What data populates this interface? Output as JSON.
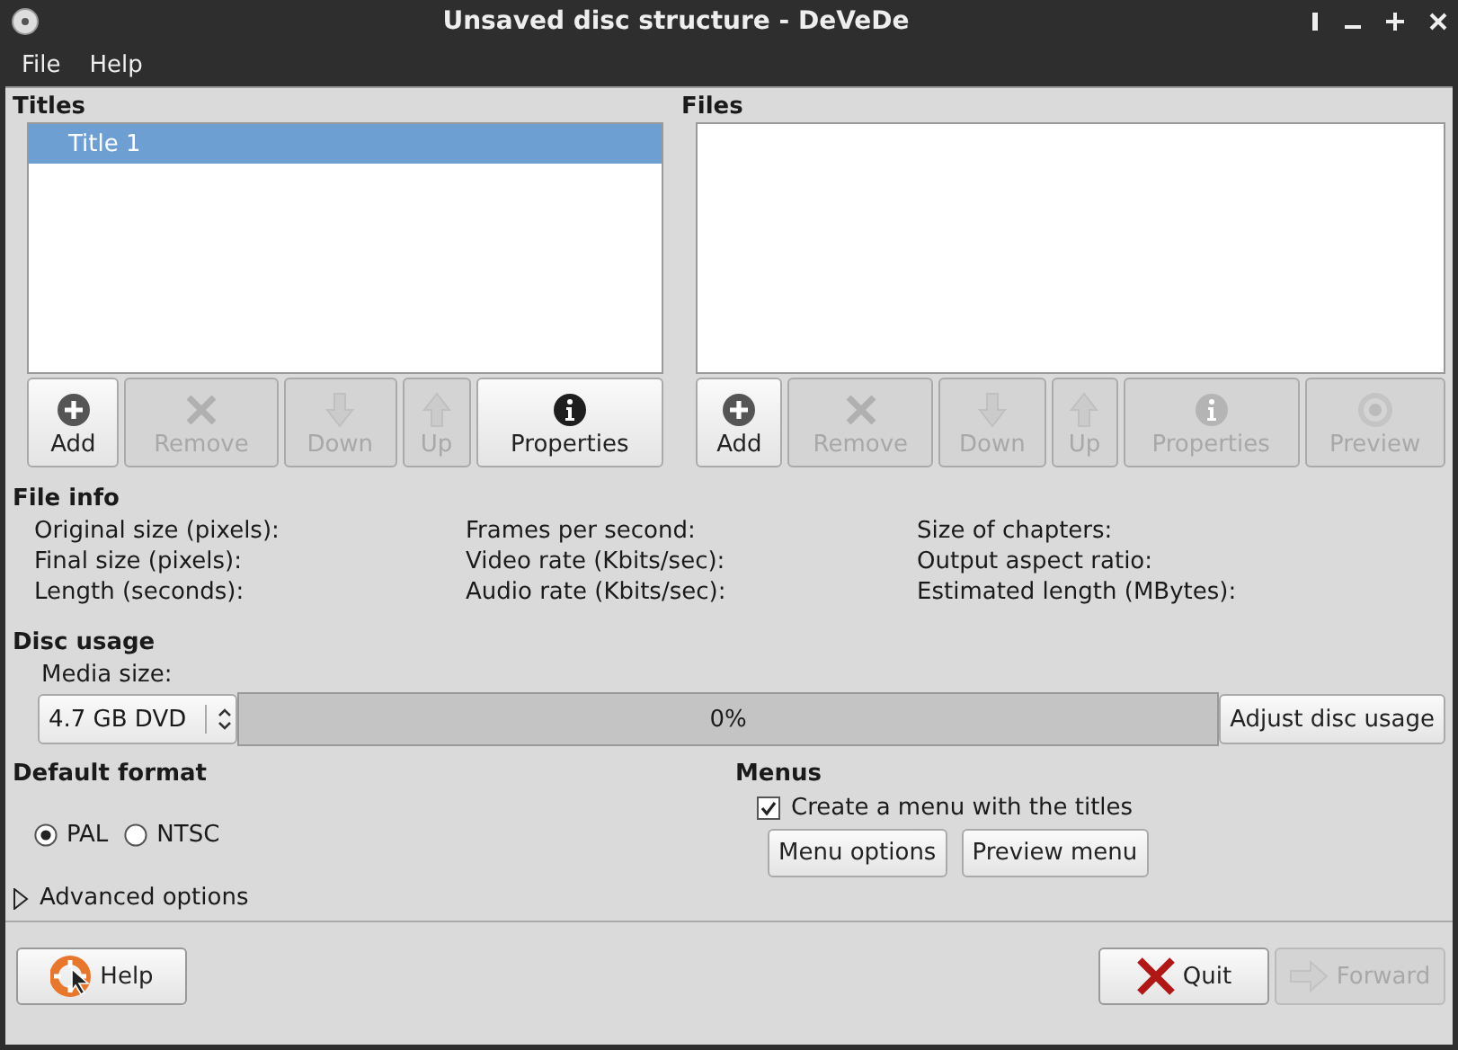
{
  "window": {
    "title": "Unsaved disc structure - DeVeDe"
  },
  "menu": [
    "File",
    "Help"
  ],
  "titles": {
    "heading": "Titles",
    "items": [
      {
        "label": "Title 1",
        "selected": true
      }
    ],
    "buttons": [
      {
        "label": "Add",
        "kind": "add",
        "disabled": false
      },
      {
        "label": "Remove",
        "kind": "remove",
        "disabled": true
      },
      {
        "label": "Down",
        "kind": "down",
        "disabled": true
      },
      {
        "label": "Up",
        "kind": "up",
        "disabled": true
      },
      {
        "label": "Properties",
        "kind": "info",
        "disabled": false
      }
    ]
  },
  "files": {
    "heading": "Files",
    "buttons": [
      {
        "label": "Add",
        "kind": "add",
        "disabled": false
      },
      {
        "label": "Remove",
        "kind": "remove",
        "disabled": true
      },
      {
        "label": "Down",
        "kind": "down",
        "disabled": true
      },
      {
        "label": "Up",
        "kind": "up",
        "disabled": true
      },
      {
        "label": "Properties",
        "kind": "info",
        "disabled": true
      },
      {
        "label": "Preview",
        "kind": "preview",
        "disabled": true
      }
    ]
  },
  "file_info": {
    "heading": "File info",
    "columns": [
      [
        "Original size (pixels):",
        "Final size (pixels):",
        "Length (seconds):"
      ],
      [
        "Frames per second:",
        "Video rate (Kbits/sec):",
        "Audio rate (Kbits/sec):"
      ],
      [
        "Size of chapters:",
        "Output aspect ratio:",
        "Estimated length (MBytes):"
      ]
    ]
  },
  "disc_usage": {
    "heading": "Disc usage",
    "media_label": "Media size:",
    "media_size": "4.7 GB DVD",
    "level": 0,
    "reading": "0%",
    "button": "Adjust disc usage"
  },
  "default_format": {
    "heading": "Default format",
    "options": [
      {
        "label": "PAL",
        "selected": true
      },
      {
        "label": "NTSC",
        "selected": false
      }
    ]
  },
  "menus": {
    "heading": "Menus",
    "checkbox": {
      "label": "Create a menu with the titles",
      "checked": true
    },
    "buttons": [
      "Menu options",
      "Preview menu"
    ]
  },
  "advanced": {
    "label": "Advanced options",
    "expanded": false
  },
  "footer": {
    "buttons": [
      {
        "label": "Help",
        "kind": "help",
        "disabled": false
      },
      {
        "label": "Quit",
        "kind": "quit",
        "disabled": false
      },
      {
        "label": "Forward",
        "kind": "forward",
        "disabled": true
      }
    ]
  }
}
